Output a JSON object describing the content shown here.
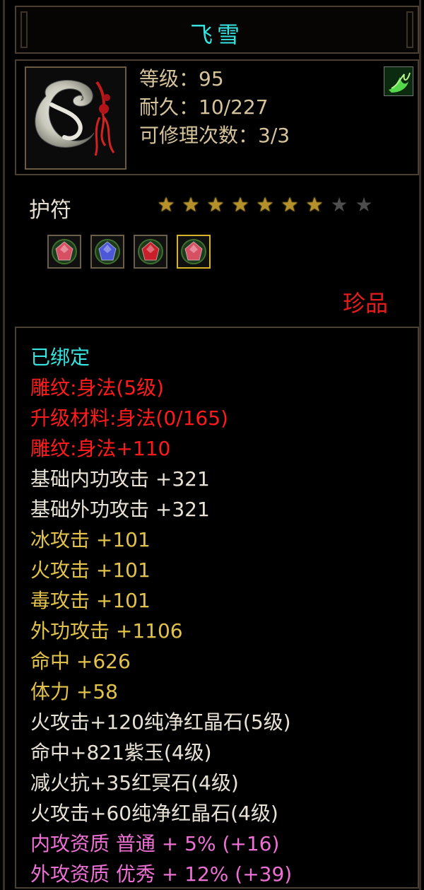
{
  "item": {
    "name": "飞雪",
    "level_line": "等级：95",
    "durability_line": "耐久：10/227",
    "repair_line": "可修理次数：3/3",
    "type": "护符",
    "rarity": "珍品",
    "icon": "jade-amulet-icon",
    "skill_icon": "green-flame-icon",
    "stars": {
      "filled": 7,
      "total": 9
    }
  },
  "gems": [
    {
      "name": "green-gem-icon",
      "color": "#d64f63",
      "selected": false
    },
    {
      "name": "blue-gem-icon",
      "color": "#4c58d8",
      "selected": false
    },
    {
      "name": "red-gem-icon",
      "color": "#c8202a",
      "selected": false
    },
    {
      "name": "green-gem-icon",
      "color": "#d64f63",
      "selected": true
    }
  ],
  "colors": {
    "cyan": "#35e3df",
    "red": "#ff1b1b",
    "white": "#e8e2d6",
    "gold": "#e2c24a",
    "pink": "#ee70d4"
  },
  "attributes": [
    {
      "text": "已绑定",
      "color": "cyan"
    },
    {
      "text": "雕纹:身法(5级)",
      "color": "red"
    },
    {
      "text": "升级材料:身法(0/165)",
      "color": "red"
    },
    {
      "text": "雕纹:身法+110",
      "color": "red"
    },
    {
      "text": "基础内功攻击 +321",
      "color": "white"
    },
    {
      "text": "基础外功攻击 +321",
      "color": "white"
    },
    {
      "text": "冰攻击 +101",
      "color": "gold"
    },
    {
      "text": "火攻击 +101",
      "color": "gold"
    },
    {
      "text": "毒攻击 +101",
      "color": "gold"
    },
    {
      "text": "外功攻击 +1106",
      "color": "gold"
    },
    {
      "text": "命中 +626",
      "color": "gold"
    },
    {
      "text": "体力 +58",
      "color": "gold"
    },
    {
      "text": "火攻击+120纯净红晶石(5级)",
      "color": "white"
    },
    {
      "text": "命中+821紫玉(4级)",
      "color": "white"
    },
    {
      "text": "减火抗+35红冥石(4级)",
      "color": "white"
    },
    {
      "text": "火攻击+60纯净红晶石(4级)",
      "color": "white"
    },
    {
      "text": "内攻资质 普通 + 5% (+16)",
      "color": "pink"
    },
    {
      "text": "外攻资质 优秀 + 12% (+39)",
      "color": "pink"
    }
  ]
}
